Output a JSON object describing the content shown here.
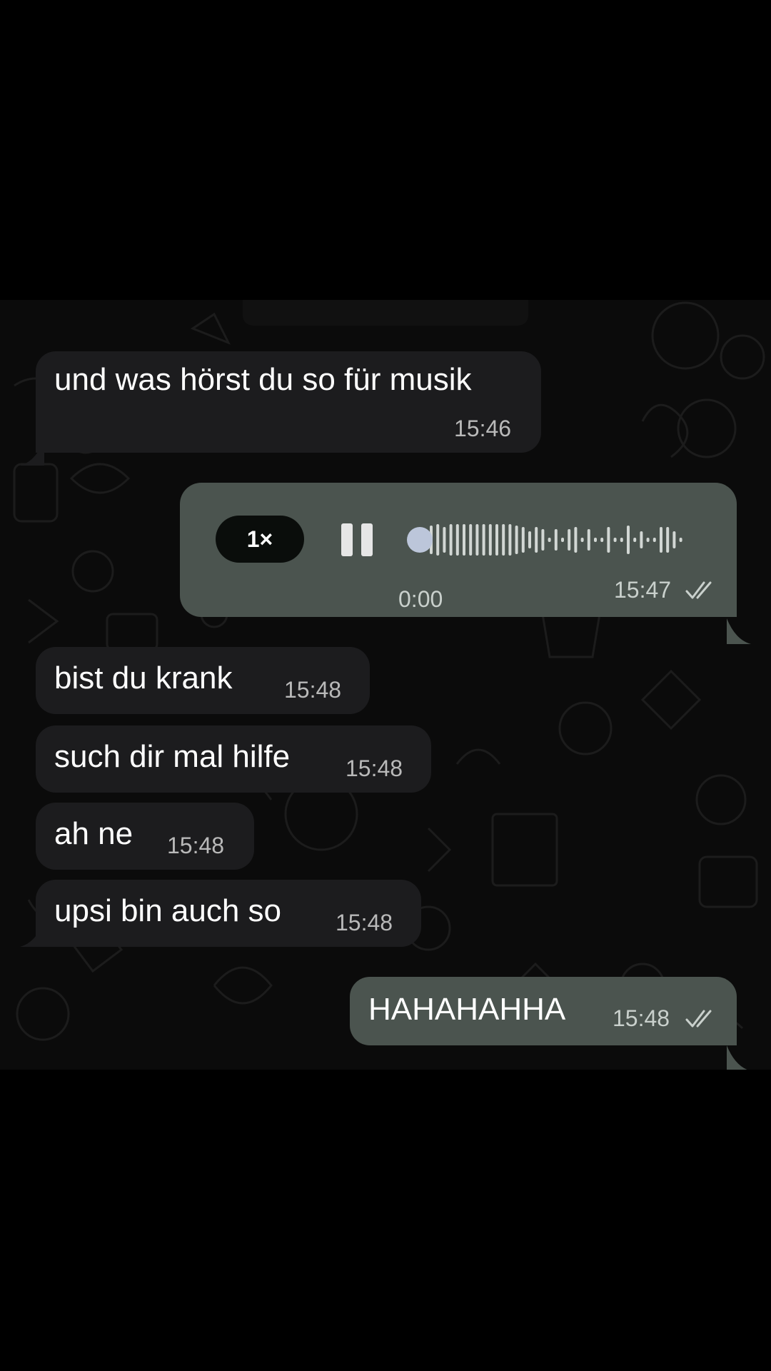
{
  "chat": {
    "messages": [
      {
        "direction": "incoming",
        "type": "text",
        "text": "und was hörst du so für musik",
        "time": "15:46"
      },
      {
        "direction": "outgoing",
        "type": "voice",
        "speed": "1×",
        "duration": "0:00",
        "progress": 0,
        "time": "15:47",
        "status": "read-double-check"
      },
      {
        "direction": "incoming",
        "type": "text",
        "text": "bist du krank",
        "time": "15:48"
      },
      {
        "direction": "incoming",
        "type": "text",
        "text": "such dir mal hilfe",
        "time": "15:48"
      },
      {
        "direction": "incoming",
        "type": "text",
        "text": "ah ne",
        "time": "15:48"
      },
      {
        "direction": "incoming",
        "type": "text",
        "text": "upsi bin auch so",
        "time": "15:48"
      },
      {
        "direction": "outgoing",
        "type": "text",
        "text": "HAHAHAHHA",
        "time": "15:48",
        "status": "read-double-check"
      }
    ]
  },
  "colors": {
    "background": "#000000",
    "chat_wallpaper": "#0b0b0b",
    "incoming_bubble": "#1c1c1e",
    "outgoing_bubble": "#4b544f",
    "timestamp": "#b9b9b9",
    "playhead": "#bcc6da"
  },
  "icons": [
    "pause-icon",
    "double-check-icon",
    "playhead-dot"
  ]
}
